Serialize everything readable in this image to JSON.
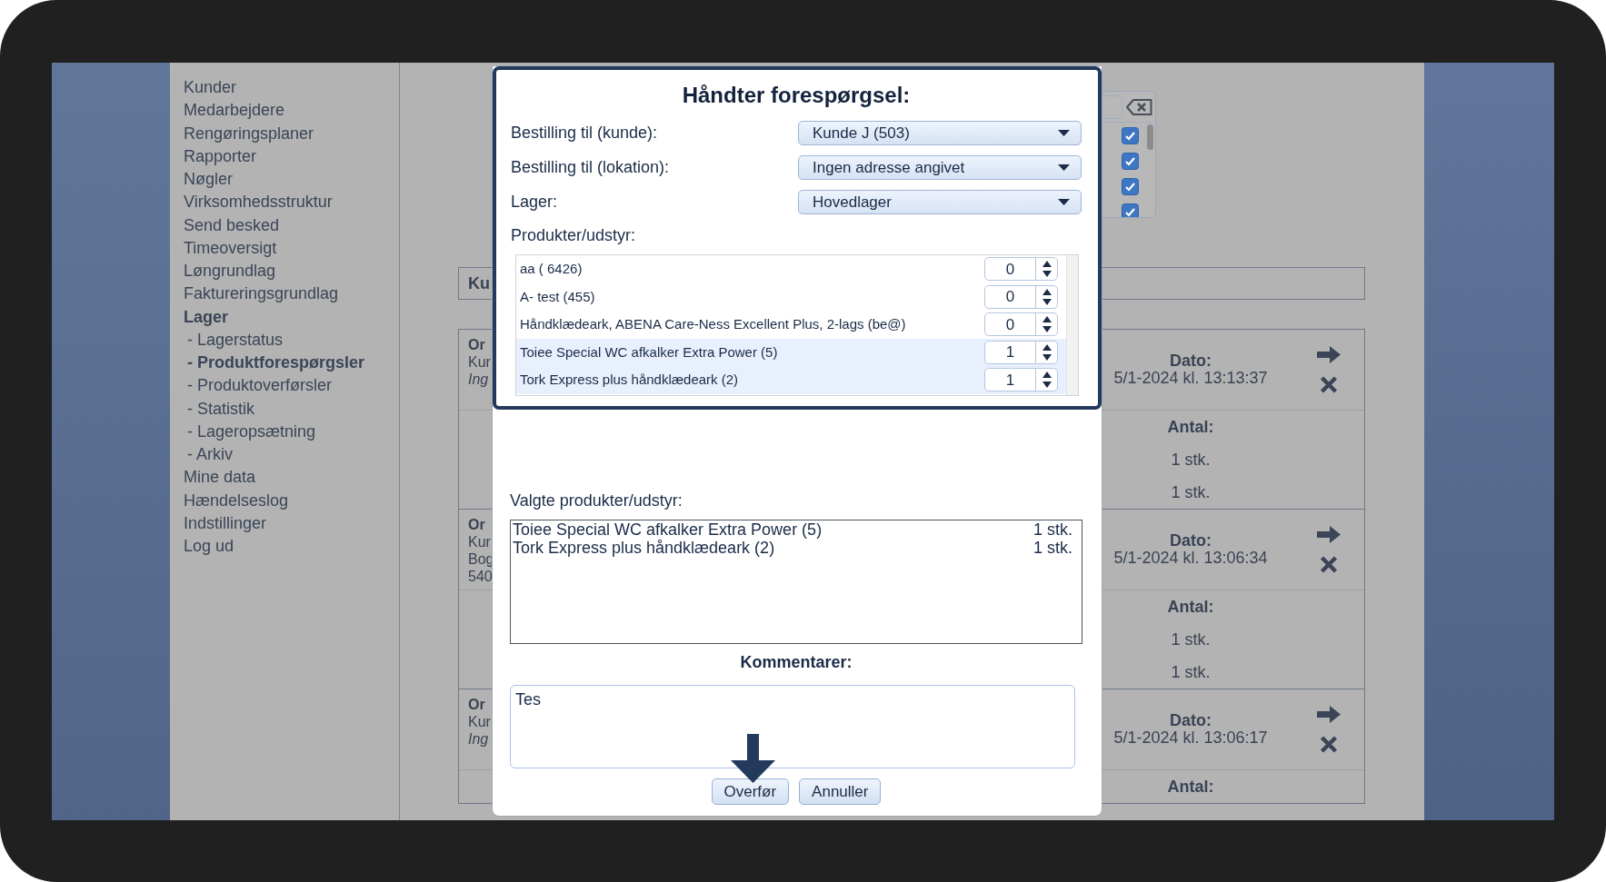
{
  "sidebar": {
    "items": [
      {
        "label": "Kunder",
        "selected": false
      },
      {
        "label": "Medarbejdere",
        "selected": false
      },
      {
        "label": "Rengøringsplaner",
        "selected": false
      },
      {
        "label": "Rapporter",
        "selected": false
      },
      {
        "label": "Nøgler",
        "selected": false
      },
      {
        "label": "Virksomhedsstruktur",
        "selected": false
      },
      {
        "label": "Send besked",
        "selected": false
      },
      {
        "label": "Timeoversigt",
        "selected": false
      },
      {
        "label": "Løngrundlag",
        "selected": false
      },
      {
        "label": "Faktureringsgrundlag",
        "selected": false
      },
      {
        "label": "Lager",
        "selected": true,
        "children": [
          {
            "label": "- Lagerstatus",
            "selected": false
          },
          {
            "label": "- Produktforespørgsler",
            "selected": true
          },
          {
            "label": "- Produktoverførsler",
            "selected": false
          },
          {
            "label": "- Statistik",
            "selected": false
          },
          {
            "label": "- Lageropsætning",
            "selected": false
          },
          {
            "label": "- Arkiv",
            "selected": false
          }
        ]
      },
      {
        "label": "Mine data",
        "selected": false
      },
      {
        "label": "Hændelseslog",
        "selected": false
      },
      {
        "label": "Indstillinger",
        "selected": false
      },
      {
        "label": "Log ud",
        "selected": false
      }
    ]
  },
  "filter": {
    "items": [
      {
        "checked": true
      },
      {
        "checked": true
      },
      {
        "checked": true
      },
      {
        "checked": true
      }
    ]
  },
  "info_bar": {
    "text": "Ku"
  },
  "orders": [
    {
      "title": "Or",
      "lines": [
        {
          "text": "Kur",
          "kind": "text"
        },
        {
          "text": "Ing",
          "kind": "note"
        }
      ],
      "date_label": "Dato:",
      "date": "5/1-2024 kl. 13:13:37",
      "quantity_label": "Antal:",
      "quantities": [
        "1 stk.",
        "1 stk."
      ]
    },
    {
      "title": "Or",
      "lines": [
        {
          "text": "Kur",
          "kind": "text"
        },
        {
          "text": "Bog",
          "kind": "text"
        },
        {
          "text": "540",
          "kind": "text"
        }
      ],
      "date_label": "Dato:",
      "date": "5/1-2024 kl. 13:06:34",
      "quantity_label": "Antal:",
      "quantities": [
        "1 stk.",
        "1 stk."
      ]
    },
    {
      "title": "Or",
      "lines": [
        {
          "text": "Kur",
          "kind": "text"
        },
        {
          "text": "Ing",
          "kind": "note"
        }
      ],
      "date_label": "Dato:",
      "date": "5/1-2024 kl. 13:06:17",
      "quantity_label": "Antal:"
    }
  ],
  "dialog": {
    "title": "Håndter forespørgsel:",
    "fields": [
      {
        "label": "Bestilling til (kunde):",
        "value": "Kunde J (503)"
      },
      {
        "label": "Bestilling til (lokation):",
        "value": "Ingen adresse angivet"
      },
      {
        "label": "Lager:",
        "value": "Hovedlager"
      }
    ],
    "products_label": "Produkter/udstyr:",
    "products": [
      {
        "name": "aa ( 6426)",
        "quantity": "0",
        "selected": false
      },
      {
        "name": "A- test (455)",
        "quantity": "0",
        "selected": false
      },
      {
        "name": "Håndklædeark, ABENA Care-Ness Excellent Plus, 2-lags (be@)",
        "quantity": "0",
        "selected": false
      },
      {
        "name": "Toiee Special WC afkalker Extra Power (5)",
        "quantity": "1",
        "selected": true
      },
      {
        "name": "Tork Express plus håndklædeark (2)",
        "quantity": "1",
        "selected": true
      }
    ],
    "chosen_label": "Valgte produkter/udstyr:",
    "chosen": [
      {
        "name": "Toiee Special WC afkalker Extra Power (5)",
        "quantity": "1 stk."
      },
      {
        "name": "Tork Express plus håndklædeark (2)",
        "quantity": "1 stk."
      }
    ],
    "comments_label": "Kommentarer:",
    "comments": {
      "value": "Tes"
    },
    "buttons": [
      "Overfør",
      "Annuller"
    ]
  }
}
